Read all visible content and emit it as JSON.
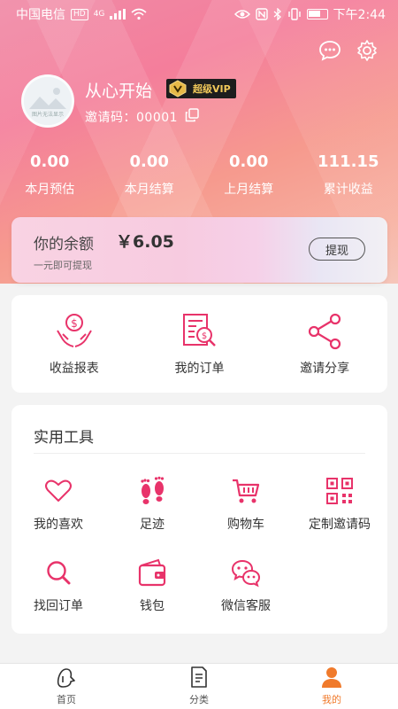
{
  "status_bar": {
    "carrier": "中国电信",
    "hd_badge": "HD",
    "network": "4G",
    "time": "下午2:44"
  },
  "profile": {
    "avatar_caption": "图片无法显示",
    "username": "从心开始",
    "vip_label": "超级VIP",
    "invite_code": "邀请码：00001"
  },
  "stats": [
    {
      "value": "0.00",
      "label": "本月预估"
    },
    {
      "value": "0.00",
      "label": "本月结算"
    },
    {
      "value": "0.00",
      "label": "上月结算"
    },
    {
      "value": "111.15",
      "label": "累计收益"
    }
  ],
  "balance": {
    "label": "你的余额",
    "amount": "￥6.05",
    "note": "一元即可提现",
    "withdraw_button": "提现"
  },
  "quick_actions": [
    {
      "label": "收益报表",
      "icon": "earnings-report-icon"
    },
    {
      "label": "我的订单",
      "icon": "orders-icon"
    },
    {
      "label": "邀请分享",
      "icon": "share-icon"
    }
  ],
  "tools": {
    "title": "实用工具",
    "items": [
      {
        "label": "我的喜欢",
        "icon": "heart-icon"
      },
      {
        "label": "足迹",
        "icon": "footprint-icon"
      },
      {
        "label": "购物车",
        "icon": "cart-icon"
      },
      {
        "label": "定制邀请码",
        "icon": "qrcode-icon"
      },
      {
        "label": "找回订单",
        "icon": "search-icon"
      },
      {
        "label": "钱包",
        "icon": "wallet-icon"
      },
      {
        "label": "微信客服",
        "icon": "wechat-icon"
      }
    ]
  },
  "tabbar": [
    {
      "label": "首页",
      "icon": "home-icon"
    },
    {
      "label": "分类",
      "icon": "category-icon"
    },
    {
      "label": "我的",
      "icon": "profile-icon",
      "active": true
    }
  ],
  "colors": {
    "accent_pink": "#e8336a",
    "active_tab": "#f07a2b",
    "vip_gold": "#f1c85a"
  }
}
